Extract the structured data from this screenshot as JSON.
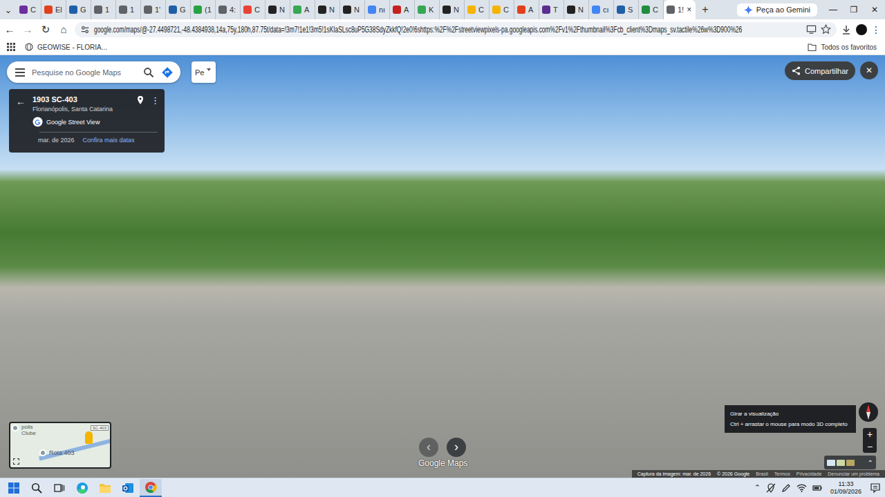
{
  "tab_strip": {
    "tab_search": "⌄",
    "tabs": [
      {
        "label": "C",
        "selected": false,
        "color": "#6b2fa0"
      },
      {
        "label": "El",
        "selected": false,
        "color": "#e2401c"
      },
      {
        "label": "G",
        "selected": false,
        "color": "#1e5fa8"
      },
      {
        "label": "1",
        "selected": false,
        "color": "#5f6368"
      },
      {
        "label": "1",
        "selected": false,
        "color": "#5f6368"
      },
      {
        "label": "1'",
        "selected": false,
        "color": "#5f6368"
      },
      {
        "label": "G",
        "selected": false,
        "color": "#1e5fa8"
      },
      {
        "label": "(1",
        "selected": false,
        "color": "#25a244"
      },
      {
        "label": "4:",
        "selected": false,
        "color": "#5f6368"
      },
      {
        "label": "C",
        "selected": false,
        "color": "#ea4335"
      },
      {
        "label": "N",
        "selected": false,
        "color": "#222222"
      },
      {
        "label": "A",
        "selected": false,
        "color": "#34a853"
      },
      {
        "label": "N",
        "selected": false,
        "color": "#222222"
      },
      {
        "label": "N",
        "selected": false,
        "color": "#222222"
      },
      {
        "label": "nı",
        "selected": false,
        "color": "#4285f4"
      },
      {
        "label": "A",
        "selected": false,
        "color": "#c5221f"
      },
      {
        "label": "K",
        "selected": false,
        "color": "#34a853"
      },
      {
        "label": "N",
        "selected": false,
        "color": "#222222"
      },
      {
        "label": "C",
        "selected": false,
        "color": "#f4b400"
      },
      {
        "label": "C",
        "selected": false,
        "color": "#f4b400"
      },
      {
        "label": "A",
        "selected": false,
        "color": "#e2401c"
      },
      {
        "label": "T",
        "selected": false,
        "color": "#5b2d90"
      },
      {
        "label": "N",
        "selected": false,
        "color": "#222222"
      },
      {
        "label": "cı",
        "selected": false,
        "color": "#4285f4"
      },
      {
        "label": "S",
        "selected": false,
        "color": "#1e5fa8"
      },
      {
        "label": "C",
        "selected": false,
        "color": "#1e8e3e"
      },
      {
        "label": "1!",
        "selected": true,
        "color": "#5f6368"
      }
    ],
    "active_close": "×",
    "new_tab": "+",
    "gemini": "Peça ao Gemini",
    "window_controls": [
      "—",
      "❐",
      "✕"
    ]
  },
  "toolbar": {
    "nav": [
      "←",
      "→",
      "↻",
      "⌂"
    ],
    "url": "google.com/maps/@-27.4498721,-48.4384938,14a,75y,180h,87.75t/data=!3m7!1e1!3m5!1sKIaSLsc8uP5G38SdyZkkfQ!2e0!6shttps:%2F%2Fstreetviewpixels-pa.googleapis.com%2Fv1%2Fthumbnail%3Fcb_client%3Dmaps_sv.tactile%26w%3D900%26",
    "menu": "⋮"
  },
  "bookmarks": {
    "items": [
      "GEOWISE - FLORIA..."
    ],
    "all": "Todos os favoritos"
  },
  "maps": {
    "search_placeholder": "Pesquise no Google Maps",
    "layer_chip": "Pe",
    "place": {
      "back": "←",
      "title": "1903 SC-403",
      "subtitle": "Florianópolis, Santa Catarina",
      "source": "Google Street View",
      "date": "mar. de 2026",
      "more_dates": "Confira mais datas",
      "more": "⋮"
    },
    "share": "Compartilhar",
    "close": "✕",
    "tooltip": {
      "title": "Girar a visualização",
      "hint": "Ctrl + arrastar o mouse para modo 3D completo"
    },
    "zoom": [
      "+",
      "−"
    ],
    "nav_arrows": [
      "‹",
      "›"
    ],
    "watermark": "Google Maps",
    "minimap": {
      "place": "polis",
      "place2": "Clube",
      "route_badge": "SC-403",
      "route": "Rota 403"
    },
    "expand": "⌃",
    "attribution": [
      "Captura da imagem: mar. de 2026",
      "© 2026 Google",
      "Brasil",
      "Termos",
      "Privacidade",
      "Denunciar um problema"
    ]
  },
  "taskbar": {
    "tray_up": "⌃",
    "time": "11:33",
    "date": "01/09/2026"
  }
}
